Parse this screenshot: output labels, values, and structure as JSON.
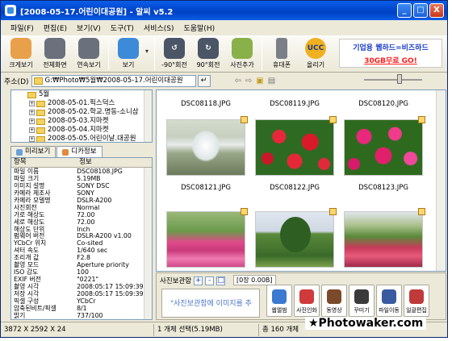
{
  "window": {
    "title": "[2008-05-17.어린이대공원] - 알씨 v5.2",
    "controls": [
      "_",
      "□",
      "X"
    ]
  },
  "menu": [
    "파일(F)",
    "편집(E)",
    "보기(V)",
    "도구(T)",
    "서비스(S)",
    "도움말(H)"
  ],
  "toolbar": {
    "buttons": [
      {
        "label": "크게보기",
        "icon": "magnifier-icon",
        "color": "#e07a32"
      },
      {
        "label": "전체화면",
        "icon": "fullscreen-icon",
        "color": "#555a66"
      },
      {
        "label": "연속보기",
        "icon": "slideshow-icon",
        "color": "#555a66"
      },
      {
        "label": "보기",
        "icon": "view-icon",
        "color": "#3d8ad8"
      },
      {
        "label": "-90°회전",
        "icon": "rotate-left-icon",
        "color": "#4a5566"
      },
      {
        "label": "90°회전",
        "icon": "rotate-right-icon",
        "color": "#4a5566"
      },
      {
        "label": "사진추가",
        "icon": "add-photo-icon",
        "color": "#8ab04a"
      },
      {
        "label": "휴대폰",
        "icon": "mobile-phone-icon",
        "color": "#7a7f88"
      },
      {
        "label": "올리기",
        "icon": "ucc-upload-icon",
        "color": "#2a6cc8"
      }
    ],
    "ad": {
      "line1": "기업용 웹하드=비즈하드",
      "line2": "30GB무료 GO!"
    }
  },
  "address": {
    "label": "주소(D)",
    "value": "G:₩Photo₩5월₩2008-05-17.어린이대공원"
  },
  "tree": [
    {
      "indent": 20,
      "pm": "",
      "label": "5월"
    },
    {
      "indent": 30,
      "pm": "+",
      "label": "2008-05-01.픽스덕스"
    },
    {
      "indent": 30,
      "pm": "+",
      "label": "2008-05-02.학교.명동-소니삼"
    },
    {
      "indent": 30,
      "pm": "+",
      "label": "2008-05-03.지마켓"
    },
    {
      "indent": 30,
      "pm": "+",
      "label": "2008-05-04.지마켓"
    },
    {
      "indent": 30,
      "pm": "+",
      "label": "2008-05-05.어린이날.대공원"
    }
  ],
  "tabs": [
    {
      "label": "미리보기",
      "active": false
    },
    {
      "label": "디카정보",
      "active": true
    }
  ],
  "info": {
    "headers": [
      "항목",
      "정보"
    ],
    "rows": [
      [
        "파일 이름",
        "DSC08108.JPG"
      ],
      [
        "파일 크기",
        "5.19MB"
      ],
      [
        "이미지 설명",
        "SONY DSC"
      ],
      [
        "카메라 제조사",
        "SONY"
      ],
      [
        "카메라 모델명",
        "DSLR-A200"
      ],
      [
        "사진회전",
        "Normal"
      ],
      [
        "가로 해상도",
        "72.00"
      ],
      [
        "세로 해상도",
        "72.00"
      ],
      [
        "해상도 단위",
        "Inch"
      ],
      [
        "펌웨어 버전",
        "DSLR-A200 v1.00"
      ],
      [
        "YCbCr 위치",
        "Co-sited"
      ],
      [
        "셔터 속도",
        "1/640 sec"
      ],
      [
        "조리개 값",
        "F2.8"
      ],
      [
        "촬영 모드",
        "Aperture priority"
      ],
      [
        "ISO 감도",
        "100"
      ],
      [
        "EXIF 버전",
        "\"0221\""
      ],
      [
        "촬영 시각",
        "2008:05:17 15:09:39"
      ],
      [
        "저장 시각",
        "2008:05:17 15:09:39"
      ],
      [
        "픽셀 구성",
        "YCbCr"
      ],
      [
        "압축된비트/픽셀",
        "8/1"
      ],
      [
        "밝기",
        "737/100"
      ],
      [
        "노출 보정",
        "0/10"
      ]
    ]
  },
  "grid": {
    "top_row": [
      "DSC08118.JPG",
      "DSC08119.JPG",
      "DSC08120.JPG"
    ],
    "thumbs": [
      {
        "caption": "DSC08121.JPG",
        "kind": "fountain"
      },
      {
        "caption": "DSC08122.JPG",
        "kind": "flowers"
      },
      {
        "caption": "DSC08123.JPG",
        "kind": "flowers2"
      },
      {
        "caption": "",
        "kind": "garden"
      },
      {
        "caption": "",
        "kind": "tree"
      },
      {
        "caption": "",
        "kind": "field"
      }
    ]
  },
  "photobox": {
    "title": "사진보관함",
    "controls": [
      "+",
      "-",
      "□"
    ],
    "count": "[0장 0.00B]",
    "drop_text": "\"사진보관함에 이미지를 추",
    "tools": [
      {
        "label": "웹앨범",
        "icon": "web-album-icon",
        "color": "#3a7ad0"
      },
      {
        "label": "사진인화",
        "icon": "photo-print-icon",
        "color": "#d03a3a"
      },
      {
        "label": "동영상",
        "icon": "video-icon",
        "color": "#7a4a2a"
      },
      {
        "label": "꾸미기",
        "icon": "decorate-icon",
        "color": "#3a3a3a"
      },
      {
        "label": "파일이동",
        "icon": "file-move-icon",
        "color": "#3a5aa0"
      },
      {
        "label": "일괄편집",
        "icon": "batch-edit-icon",
        "color": "#c03a3a"
      }
    ]
  },
  "status": {
    "dimensions": "3872 X 2592 X 24",
    "selection": "1 개체 선택(5.19MB)",
    "total": "총 160 개체"
  },
  "watermark": "★Photowaker.com"
}
